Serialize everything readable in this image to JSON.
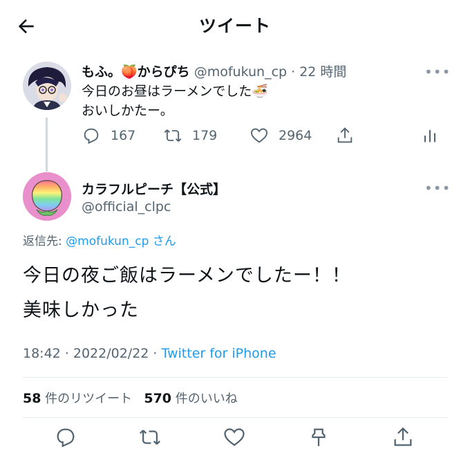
{
  "header": {
    "title": "ツイート"
  },
  "tweet1": {
    "name": "もふ。🍑からぴち",
    "handle": "@mofukun_cp",
    "time": "· 22 時間",
    "text_line1": "今日のお昼はラーメンでした🍜",
    "text_line2": "おいしかたー。",
    "replies": "167",
    "retweets": "179",
    "likes": "2964",
    "more": "•••"
  },
  "tweet2": {
    "name": "カラフルピーチ【公式】",
    "handle": "@official_clpc",
    "more": "•••",
    "reply_prefix": "返信先: ",
    "reply_handle": "@mofukun_cp",
    "reply_suffix": " さん",
    "text_line1": "今日の夜ご飯はラーメンでしたー！！",
    "text_line2": "美味しかった",
    "time": "18:42 · 2022/02/22 · ",
    "source": "Twitter for iPhone",
    "retweet_count": "58",
    "retweet_label": " 件のリツイート",
    "like_count": "570",
    "like_label": " 件のいいね"
  },
  "colors": {
    "link": "#1d9bf0",
    "muted": "#536471",
    "avatar2_bg": "#e98fcc"
  }
}
